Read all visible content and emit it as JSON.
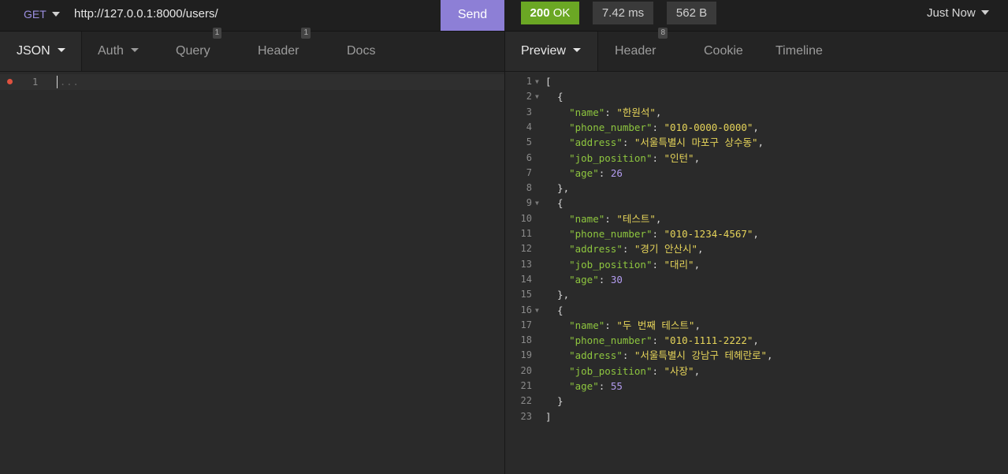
{
  "request": {
    "method": "GET",
    "url": "http://127.0.0.1:8000/users/",
    "send_label": "Send",
    "tabs": [
      {
        "label": "JSON",
        "badge": ""
      },
      {
        "label": "Auth",
        "badge": ""
      },
      {
        "label": "Query",
        "badge": "1"
      },
      {
        "label": "Header",
        "badge": "1"
      },
      {
        "label": "Docs",
        "badge": ""
      }
    ],
    "body_line_number": "1",
    "body_placeholder": "..."
  },
  "response": {
    "status_code": "200",
    "status_text": "OK",
    "time": "7.42 ms",
    "size": "562 B",
    "history_label": "Just Now",
    "tabs": [
      {
        "label": "Preview",
        "badge": ""
      },
      {
        "label": "Header",
        "badge": "8"
      },
      {
        "label": "Cookie",
        "badge": ""
      },
      {
        "label": "Timeline",
        "badge": ""
      }
    ],
    "users": [
      {
        "name": "한원석",
        "phone_number": "010-0000-0000",
        "address": "서울특별시 마포구 상수동",
        "job_position": "인턴",
        "age": 26
      },
      {
        "name": "테스트",
        "phone_number": "010-1234-4567",
        "address": "경기 안산시",
        "job_position": "대리",
        "age": 30
      },
      {
        "name": "두 번째 테스트",
        "phone_number": "010-1111-2222",
        "address": "서울특별시 강남구 테헤란로",
        "job_position": "사장",
        "age": 55
      }
    ]
  },
  "colors": {
    "accent": "#8d7fd6",
    "status_ok": "#6ba724",
    "json_key": "#8ec63f",
    "json_string": "#e6d45a",
    "json_number": "#b39cf0",
    "error_dot": "#e0523f"
  }
}
